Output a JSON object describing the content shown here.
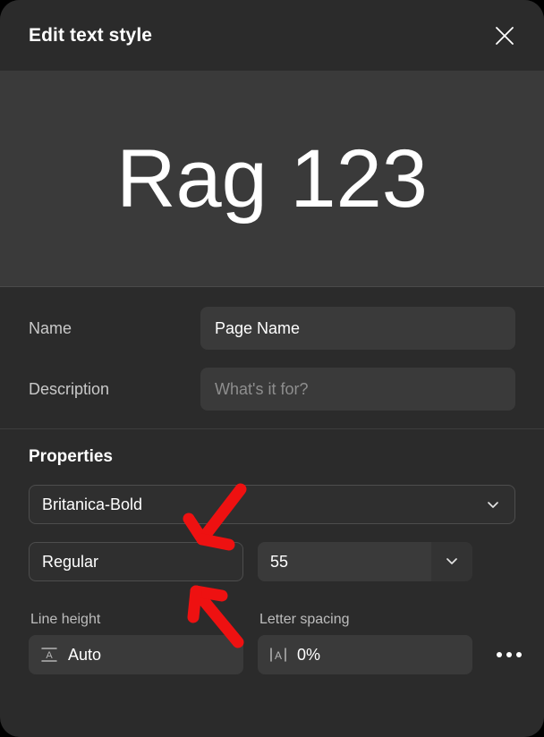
{
  "header": {
    "title": "Edit text style",
    "close_icon": "close-icon"
  },
  "preview": {
    "sample_text": "Rag 123"
  },
  "form": {
    "name_label": "Name",
    "name_value": "Page Name",
    "name_placeholder": "",
    "description_label": "Description",
    "description_value": "",
    "description_placeholder": "What's it for?"
  },
  "properties": {
    "title": "Properties",
    "font_family": "Britanica-Bold",
    "font_family_chevron": "chevron-down-icon",
    "font_weight": "Regular",
    "font_size": "55",
    "font_size_chevron": "chevron-down-icon",
    "line_height_label": "Line height",
    "line_height_value": "Auto",
    "line_height_icon": "line-height-icon",
    "letter_spacing_label": "Letter spacing",
    "letter_spacing_value": "0%",
    "letter_spacing_icon": "letter-spacing-icon",
    "more_options_icon": "more-horizontal-icon"
  },
  "annotations": {
    "accent_color": "#ee1111",
    "arrow_1_target": "font-family-select",
    "arrow_2_target": "font-weight-select"
  },
  "colors": {
    "panel_bg": "#2b2b2b",
    "preview_bg": "#3a3a3a",
    "input_bg": "#3a3a3a",
    "text_primary": "#ffffff",
    "text_secondary": "#c9c9c9",
    "placeholder": "#8e8e8e",
    "border": "#4d4d4d"
  }
}
